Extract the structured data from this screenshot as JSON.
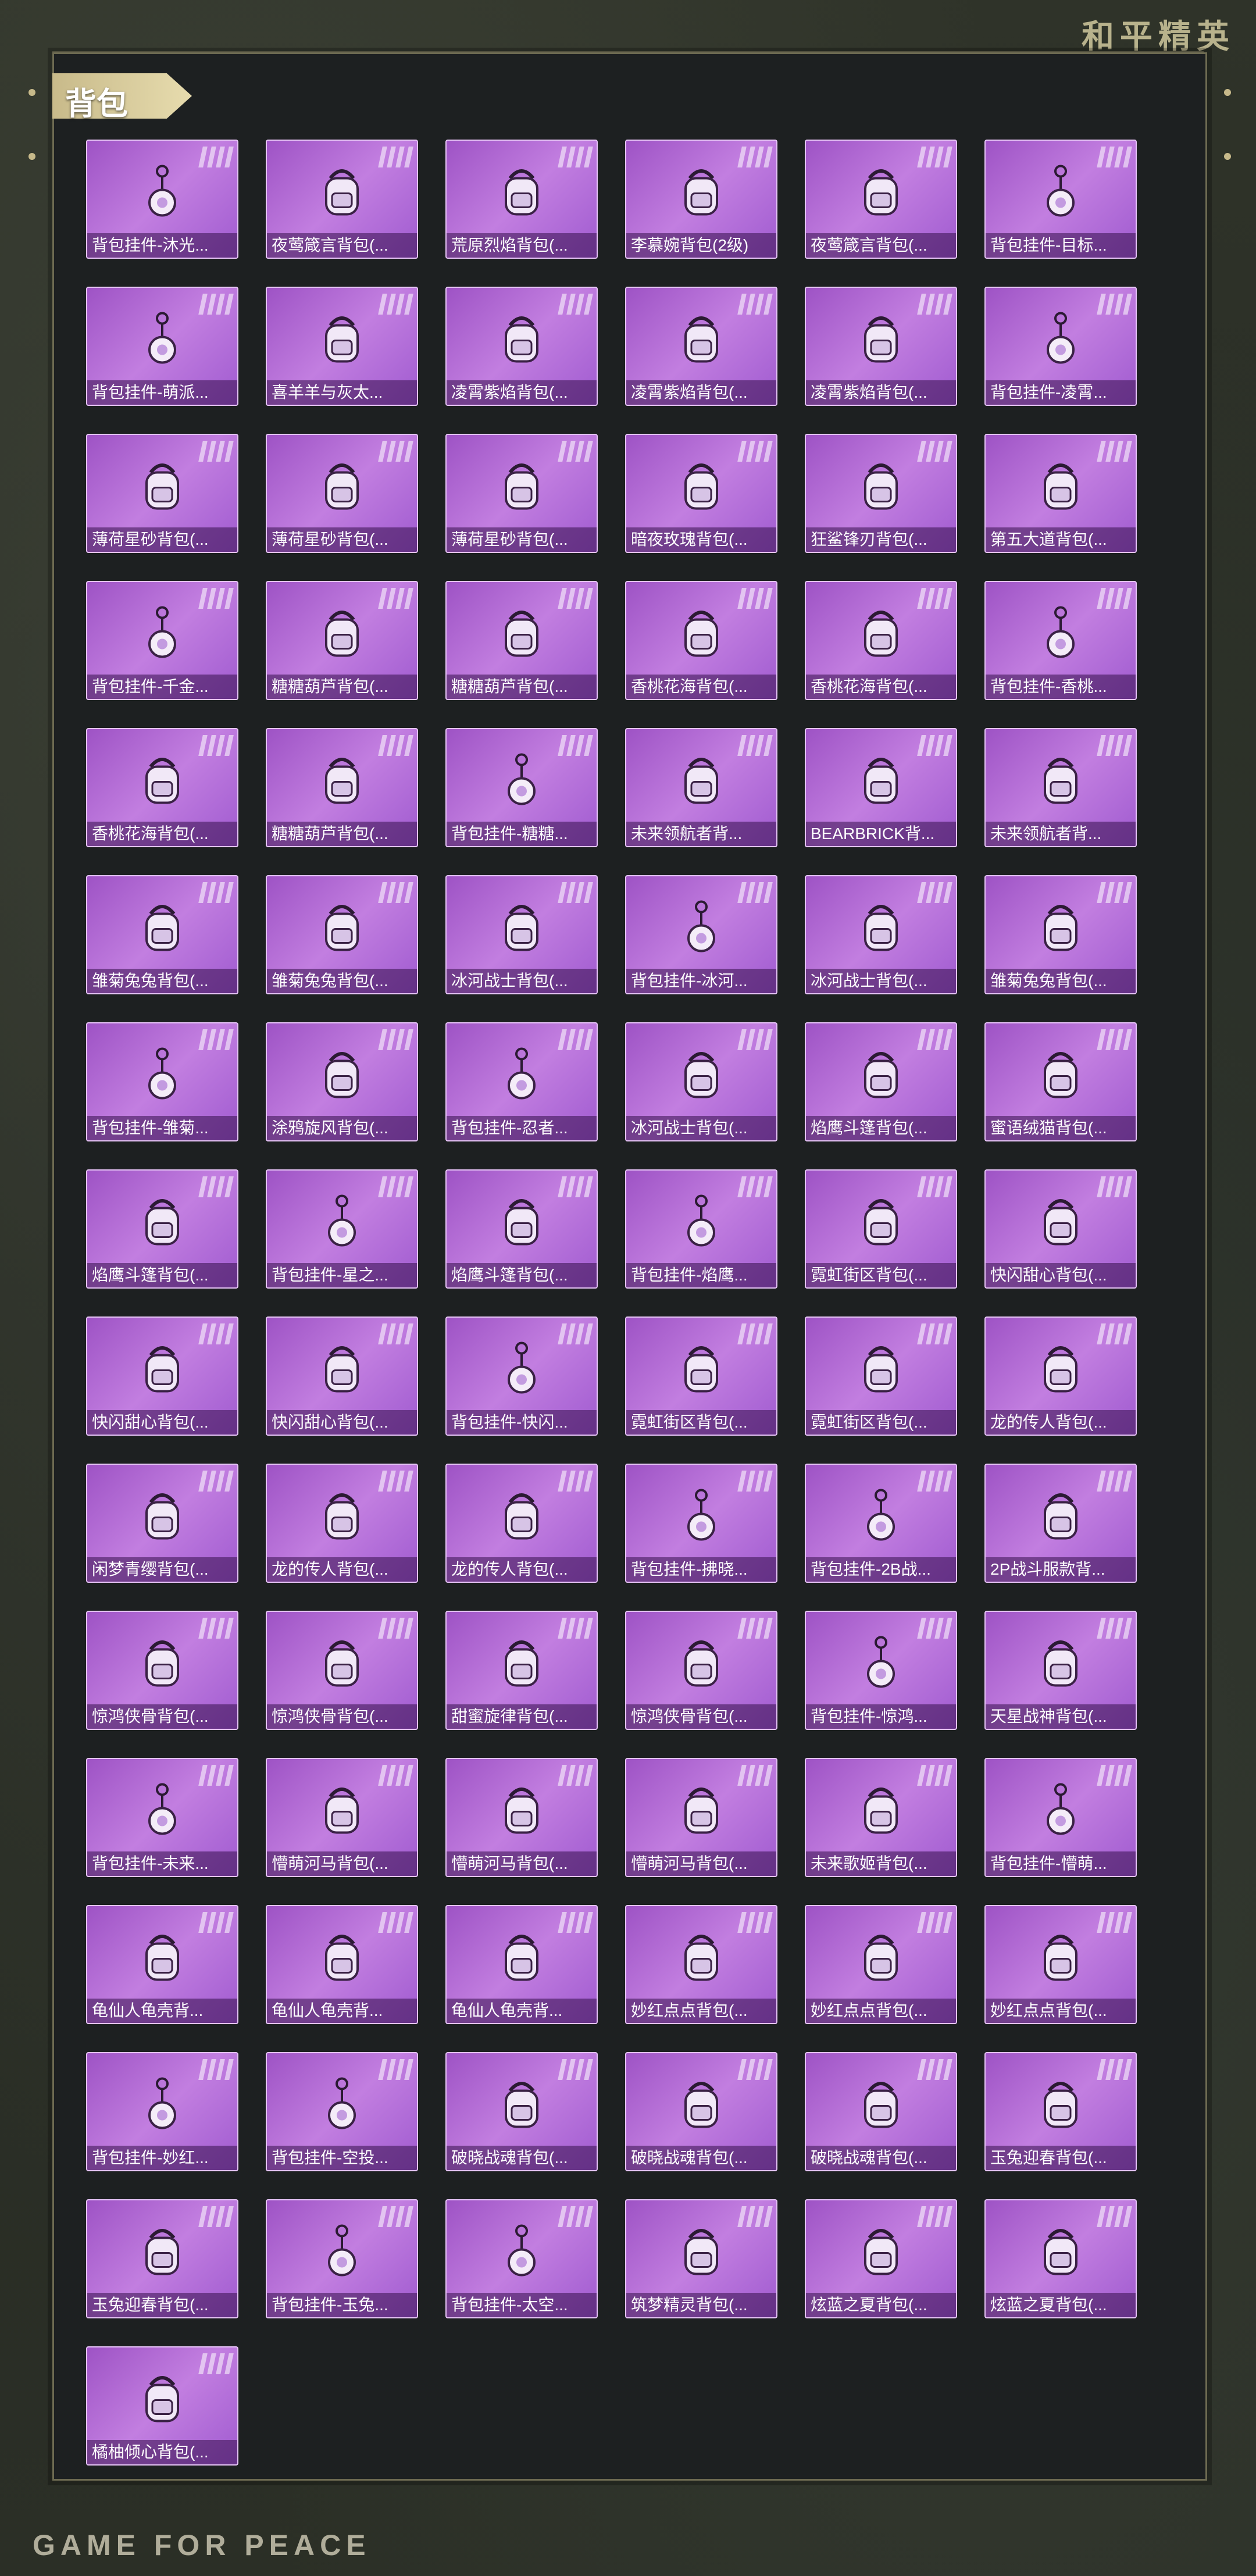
{
  "brand": {
    "logo_text": "和平精英",
    "footer_text": "GAME FOR PEACE"
  },
  "section": {
    "title": "背包"
  },
  "colors": {
    "tile_purple": "#a95ad1",
    "tile_border": "#e6c3f6",
    "panel_bg": "#1d2021",
    "frame_gold": "#c8ba8a"
  },
  "items": [
    {
      "label": "背包挂件-沐光...",
      "icon": "pendant-icon"
    },
    {
      "label": "夜莺箴言背包(...",
      "icon": "backpack-icon"
    },
    {
      "label": "荒原烈焰背包(...",
      "icon": "backpack-icon"
    },
    {
      "label": "李慕婉背包(2级)",
      "icon": "backpack-icon"
    },
    {
      "label": "夜莺箴言背包(...",
      "icon": "backpack-icon"
    },
    {
      "label": "背包挂件-目标...",
      "icon": "pendant-icon"
    },
    {
      "label": "背包挂件-萌派...",
      "icon": "pendant-icon"
    },
    {
      "label": "喜羊羊与灰太...",
      "icon": "backpack-icon"
    },
    {
      "label": "凌霄紫焰背包(...",
      "icon": "backpack-icon"
    },
    {
      "label": "凌霄紫焰背包(...",
      "icon": "backpack-icon"
    },
    {
      "label": "凌霄紫焰背包(...",
      "icon": "backpack-icon"
    },
    {
      "label": "背包挂件-凌霄...",
      "icon": "pendant-icon"
    },
    {
      "label": "薄荷星砂背包(...",
      "icon": "backpack-icon"
    },
    {
      "label": "薄荷星砂背包(...",
      "icon": "backpack-icon"
    },
    {
      "label": "薄荷星砂背包(...",
      "icon": "backpack-icon"
    },
    {
      "label": "暗夜玫瑰背包(...",
      "icon": "backpack-icon"
    },
    {
      "label": "狂鲨锋刃背包(...",
      "icon": "backpack-icon"
    },
    {
      "label": "第五大道背包(...",
      "icon": "backpack-icon"
    },
    {
      "label": "背包挂件-千金...",
      "icon": "pendant-icon"
    },
    {
      "label": "糖糖葫芦背包(...",
      "icon": "backpack-icon"
    },
    {
      "label": "糖糖葫芦背包(...",
      "icon": "backpack-icon"
    },
    {
      "label": "香桃花海背包(...",
      "icon": "backpack-icon"
    },
    {
      "label": "香桃花海背包(...",
      "icon": "backpack-icon"
    },
    {
      "label": "背包挂件-香桃...",
      "icon": "pendant-icon"
    },
    {
      "label": "香桃花海背包(...",
      "icon": "backpack-icon"
    },
    {
      "label": "糖糖葫芦背包(...",
      "icon": "backpack-icon"
    },
    {
      "label": "背包挂件-糖糖...",
      "icon": "pendant-icon"
    },
    {
      "label": "未来领航者背...",
      "icon": "backpack-icon"
    },
    {
      "label": "BEARBRICK背...",
      "icon": "backpack-icon"
    },
    {
      "label": "未来领航者背...",
      "icon": "backpack-icon"
    },
    {
      "label": "雏菊兔兔背包(...",
      "icon": "backpack-icon"
    },
    {
      "label": "雏菊兔兔背包(...",
      "icon": "backpack-icon"
    },
    {
      "label": "冰河战士背包(...",
      "icon": "backpack-icon"
    },
    {
      "label": "背包挂件-冰河...",
      "icon": "pendant-icon"
    },
    {
      "label": "冰河战士背包(...",
      "icon": "backpack-icon"
    },
    {
      "label": "雏菊兔兔背包(...",
      "icon": "backpack-icon"
    },
    {
      "label": "背包挂件-雏菊...",
      "icon": "pendant-icon"
    },
    {
      "label": "涂鸦旋风背包(...",
      "icon": "backpack-icon"
    },
    {
      "label": "背包挂件-忍者...",
      "icon": "pendant-icon"
    },
    {
      "label": "冰河战士背包(...",
      "icon": "backpack-icon"
    },
    {
      "label": "焰鹰斗篷背包(...",
      "icon": "backpack-icon"
    },
    {
      "label": "蜜语绒猫背包(...",
      "icon": "backpack-icon"
    },
    {
      "label": "焰鹰斗篷背包(...",
      "icon": "backpack-icon"
    },
    {
      "label": "背包挂件-星之...",
      "icon": "pendant-icon"
    },
    {
      "label": "焰鹰斗篷背包(...",
      "icon": "backpack-icon"
    },
    {
      "label": "背包挂件-焰鹰...",
      "icon": "pendant-icon"
    },
    {
      "label": "霓虹街区背包(...",
      "icon": "backpack-icon"
    },
    {
      "label": "快闪甜心背包(...",
      "icon": "backpack-icon"
    },
    {
      "label": "快闪甜心背包(...",
      "icon": "backpack-icon"
    },
    {
      "label": "快闪甜心背包(...",
      "icon": "backpack-icon"
    },
    {
      "label": "背包挂件-快闪...",
      "icon": "pendant-icon"
    },
    {
      "label": "霓虹街区背包(...",
      "icon": "backpack-icon"
    },
    {
      "label": "霓虹街区背包(...",
      "icon": "backpack-icon"
    },
    {
      "label": "龙的传人背包(...",
      "icon": "backpack-icon"
    },
    {
      "label": "闲梦青缨背包(...",
      "icon": "backpack-icon"
    },
    {
      "label": "龙的传人背包(...",
      "icon": "backpack-icon"
    },
    {
      "label": "龙的传人背包(...",
      "icon": "backpack-icon"
    },
    {
      "label": "背包挂件-拂晓...",
      "icon": "pendant-icon"
    },
    {
      "label": "背包挂件-2B战...",
      "icon": "pendant-icon"
    },
    {
      "label": "2P战斗服款背...",
      "icon": "backpack-icon"
    },
    {
      "label": "惊鸿侠骨背包(...",
      "icon": "backpack-icon"
    },
    {
      "label": "惊鸿侠骨背包(...",
      "icon": "backpack-icon"
    },
    {
      "label": "甜蜜旋律背包(...",
      "icon": "backpack-icon"
    },
    {
      "label": "惊鸿侠骨背包(...",
      "icon": "backpack-icon"
    },
    {
      "label": "背包挂件-惊鸿...",
      "icon": "pendant-icon"
    },
    {
      "label": "天星战神背包(...",
      "icon": "backpack-icon"
    },
    {
      "label": "背包挂件-未来...",
      "icon": "pendant-icon"
    },
    {
      "label": "懵萌河马背包(...",
      "icon": "backpack-icon"
    },
    {
      "label": "懵萌河马背包(...",
      "icon": "backpack-icon"
    },
    {
      "label": "懵萌河马背包(...",
      "icon": "backpack-icon"
    },
    {
      "label": "未来歌姬背包(...",
      "icon": "backpack-icon"
    },
    {
      "label": "背包挂件-懵萌...",
      "icon": "pendant-icon"
    },
    {
      "label": "龟仙人龟壳背...",
      "icon": "backpack-icon"
    },
    {
      "label": "龟仙人龟壳背...",
      "icon": "backpack-icon"
    },
    {
      "label": "龟仙人龟壳背...",
      "icon": "backpack-icon"
    },
    {
      "label": "妙红点点背包(...",
      "icon": "backpack-icon"
    },
    {
      "label": "妙红点点背包(...",
      "icon": "backpack-icon"
    },
    {
      "label": "妙红点点背包(...",
      "icon": "backpack-icon"
    },
    {
      "label": "背包挂件-妙红...",
      "icon": "pendant-icon"
    },
    {
      "label": "背包挂件-空投...",
      "icon": "pendant-icon"
    },
    {
      "label": "破晓战魂背包(...",
      "icon": "backpack-icon"
    },
    {
      "label": "破晓战魂背包(...",
      "icon": "backpack-icon"
    },
    {
      "label": "破晓战魂背包(...",
      "icon": "backpack-icon"
    },
    {
      "label": "玉兔迎春背包(...",
      "icon": "backpack-icon"
    },
    {
      "label": "玉兔迎春背包(...",
      "icon": "backpack-icon"
    },
    {
      "label": "背包挂件-玉兔...",
      "icon": "pendant-icon"
    },
    {
      "label": "背包挂件-太空...",
      "icon": "pendant-icon"
    },
    {
      "label": "筑梦精灵背包(...",
      "icon": "backpack-icon"
    },
    {
      "label": "炫蓝之夏背包(...",
      "icon": "backpack-icon"
    },
    {
      "label": "炫蓝之夏背包(...",
      "icon": "backpack-icon"
    },
    {
      "label": "橘柚倾心背包(...",
      "icon": "backpack-icon"
    }
  ]
}
